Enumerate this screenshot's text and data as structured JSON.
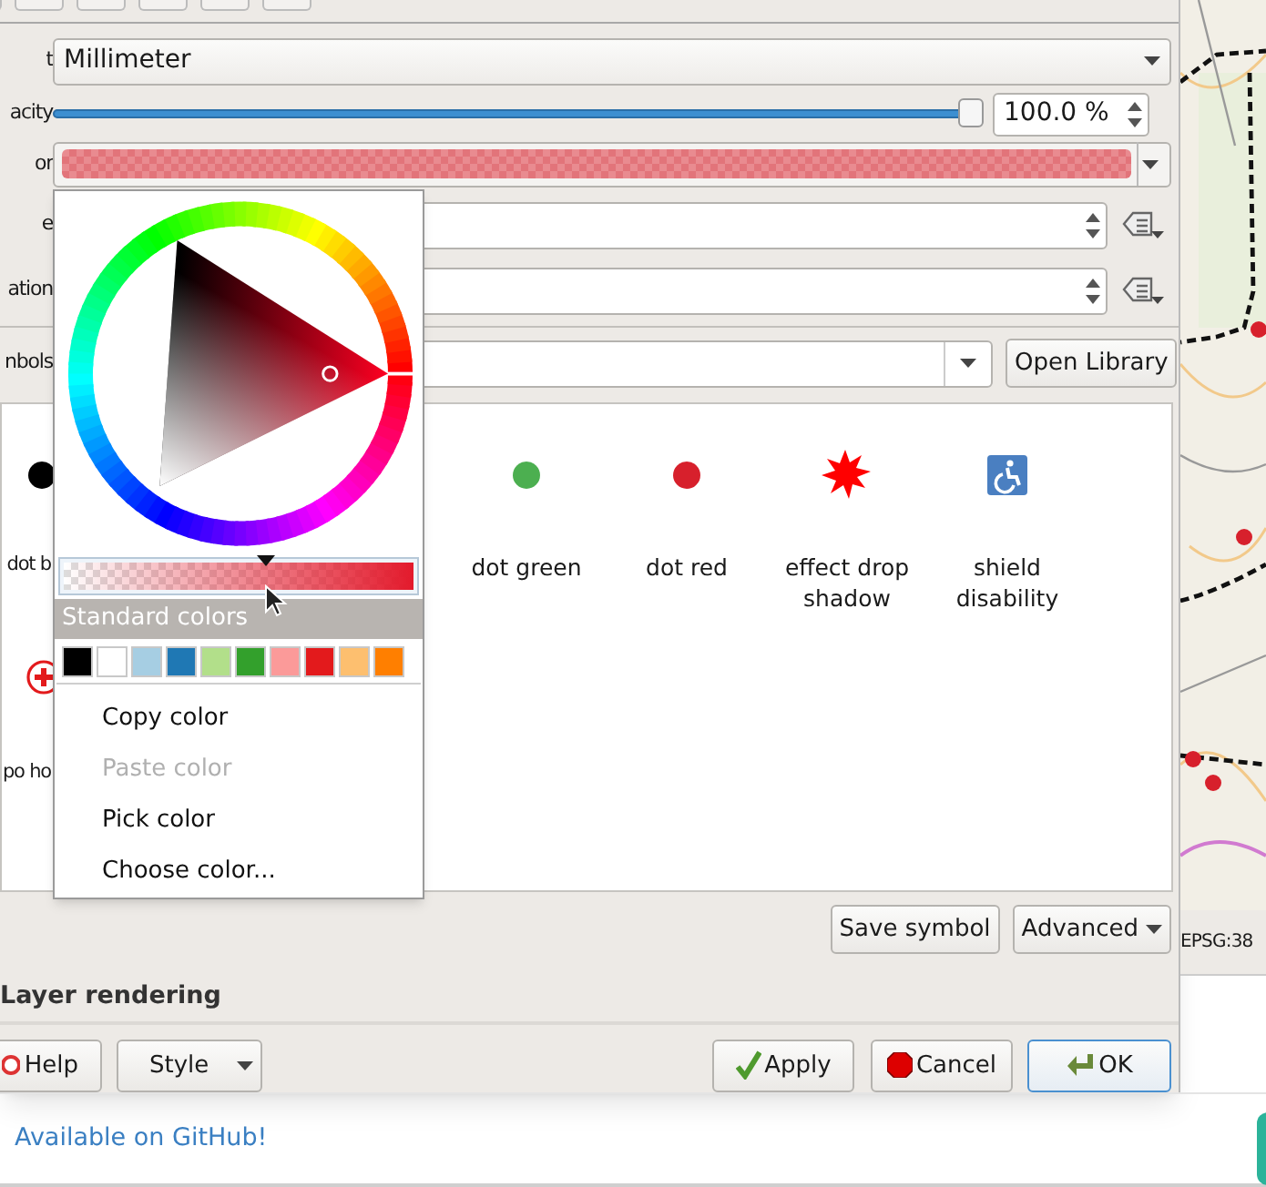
{
  "toolbar_buttons": [
    {
      "kind": "button"
    },
    {
      "kind": "button"
    },
    {
      "kind": "button"
    },
    {
      "kind": "button"
    },
    {
      "kind": "button"
    },
    {
      "kind": "button"
    }
  ],
  "unit": {
    "label": "t",
    "value": "Millimeter"
  },
  "opacity": {
    "label": "acity",
    "level": 1.0,
    "value": "100.0 %"
  },
  "color": {
    "label": "or"
  },
  "fields": [
    {
      "label": "e"
    },
    {
      "label": "ation"
    }
  ],
  "symbols": {
    "label": "nbols",
    "button": "Open Library",
    "items": [
      {
        "kind": "dot",
        "color": "#000000",
        "label": "dot b"
      },
      {
        "kind": "dot",
        "color": "#4caf50",
        "label": "dot green"
      },
      {
        "kind": "dot",
        "color": "#d7202c",
        "label": "dot red"
      },
      {
        "kind": "starburst",
        "label": "effect drop shadow"
      },
      {
        "kind": "wheelchair",
        "label": "shield disability"
      },
      {
        "kind": "cross",
        "label": "po ho"
      }
    ]
  },
  "symbol_buttons": {
    "save": "Save symbol",
    "advanced": "Advanced"
  },
  "section": "Layer rendering",
  "dialog_buttons": {
    "help": "Help",
    "style": "Style",
    "apply": "Apply",
    "cancel": "Cancel",
    "ok": "OK"
  },
  "color_popup": {
    "alpha": {
      "level": 0.58
    },
    "header": "Standard colors",
    "swatches": [
      {
        "color": "#000000"
      },
      {
        "color": "#ffffff"
      },
      {
        "color": "#a6cee3"
      },
      {
        "color": "#1f78b4"
      },
      {
        "color": "#b2df8a"
      },
      {
        "color": "#33a02c"
      },
      {
        "color": "#fb9a99"
      },
      {
        "color": "#e31a1c"
      },
      {
        "color": "#fdbf6f"
      },
      {
        "color": "#ff7f00"
      }
    ],
    "menu": [
      {
        "label": "Copy color",
        "disabled": false
      },
      {
        "label": "Paste color",
        "disabled": true
      },
      {
        "label": "Pick color",
        "disabled": false
      },
      {
        "label": "Choose color...",
        "disabled": false
      }
    ]
  },
  "status_bar": {
    "crs": "EPSG:38"
  },
  "footer": {
    "link": "Available on GitHub!"
  }
}
